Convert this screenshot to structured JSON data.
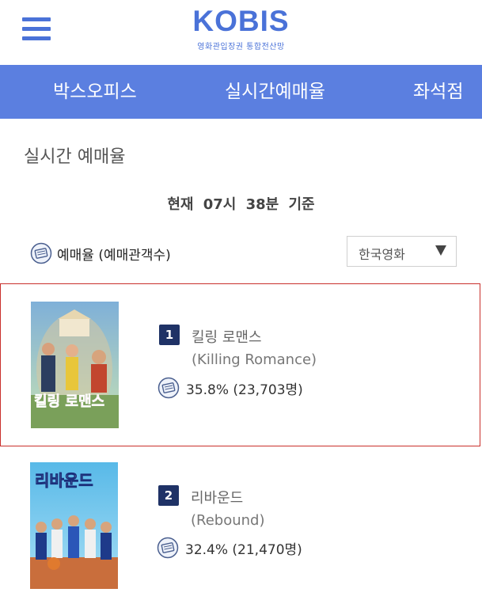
{
  "header": {
    "logo": "KOBIS",
    "logo_sub": "영화관입장권 통합전산망"
  },
  "nav": {
    "items": [
      {
        "label": "박스오피스"
      },
      {
        "label": "실시간예매율"
      },
      {
        "label": "좌석점"
      }
    ]
  },
  "page": {
    "title": "실시간 예매율",
    "time_text": "현재 07시 38분 기준"
  },
  "legend": {
    "label": "예매율 (예매관객수)",
    "icon": "ticket-icon"
  },
  "filter": {
    "selected": "한국영화"
  },
  "movies": [
    {
      "rank": "1",
      "title_kr": "킬링 로맨스",
      "title_en": "(Killing Romance)",
      "rate": "35.8% (23,703명)",
      "poster_text": "킬링 로맨스"
    },
    {
      "rank": "2",
      "title_kr": "리바운드",
      "title_en": "(Rebound)",
      "rate": "32.4% (21,470명)",
      "poster_text": "리바운드"
    }
  ],
  "colors": {
    "brand": "#4a72d8",
    "nav_bg": "#5b7fe0",
    "rank_bg": "#1f3266",
    "highlight_border": "#c9302c"
  }
}
